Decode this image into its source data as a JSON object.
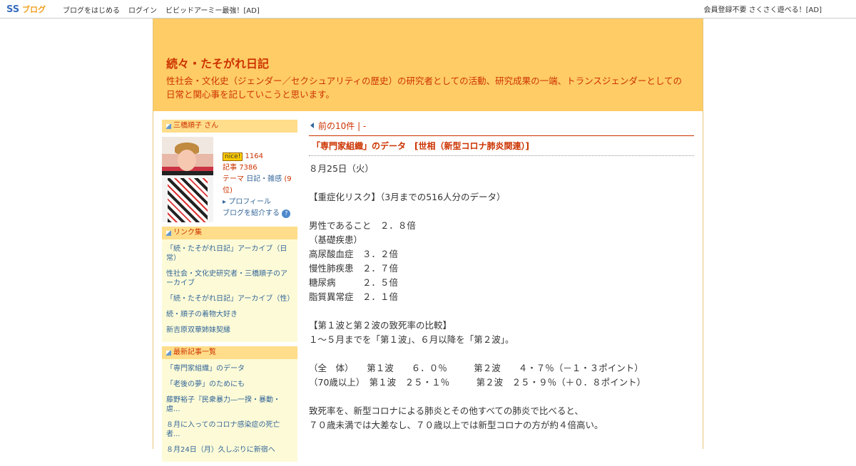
{
  "topbar": {
    "logo": "SSブログ",
    "nav": [
      "ブログをはじめる",
      "ログイン",
      "ビビッドアーミー最強！[AD]"
    ],
    "ad": "会員登録不要 さくさく遊べる！[AD]"
  },
  "header": {
    "title": "続々・たそがれ日記",
    "description": "性社会・文化史（ジェンダー／セクシュアリティの歴史）の研究者としての活動、研究成果の一端、トランスジェンダーとしての日常と関心事を記していこうと思います。"
  },
  "sidebar": {
    "profile_head": "三橋順子 さん",
    "nice_badge": "nice!",
    "nice_count": "1164",
    "articles_label": "記事",
    "articles_count": "7386",
    "theme_label": "テーマ",
    "theme_value": "日記・雑感",
    "theme_rank": "(9位)",
    "profile_link": "プロフィール",
    "introduce_link": "ブログを紹介する",
    "help_icon_text": "?",
    "links_head": "リンク集",
    "links": [
      "「続・たそがれ日記」アーカイブ（日常）",
      "性社会・文化史研究者・三橋順子のアーカイブ",
      "「続・たそがれ日記」アーカイブ（性）",
      "続・順子の着物大好き",
      "新吉原双華姉妹契縁"
    ],
    "recent_head": "最新記事一覧",
    "recent": [
      "「専門家組織」のデータ",
      "「老後の夢」のためにも",
      "藤野裕子『民衆暴力―一揆・暴動・虐...",
      "８月に入ってのコロナ感染症の死亡者...",
      "８月24日（月）久しぶりに新宿へ"
    ]
  },
  "main": {
    "pager": "前の10件 | -",
    "post_title": "「専門家組織」のデータ　[世相（新型コロナ肺炎関連）]",
    "body": [
      "８月25日（火）",
      "",
      "【重症化リスク】（3月までの516人分のデータ）",
      "",
      "男性であること　２．８倍",
      "（基礎疾患）",
      "高尿酸血症　３．２倍",
      "慢性肺疾患　２．７倍",
      "糖尿病　　　２．５倍",
      "脂質異常症　２．１倍",
      "",
      "【第１波と第２波の致死率の比較】",
      "１～５月までを「第１波」、６月以降を「第２波」。",
      "",
      "（全　体）　　第１波　　６．０％　　　第２波　　４・７％（－１・３ポイント）",
      "（70歳以上）　第１波　２５・１％　　　第２波　２５・９％（＋０．８ポイント）",
      "",
      "致死率を、新型コロナによる肺炎とその他すべての肺炎で比べると、",
      "７０歳未満では大差なし、７０歳以上では新型コロナの方が約４倍高い。"
    ]
  }
}
